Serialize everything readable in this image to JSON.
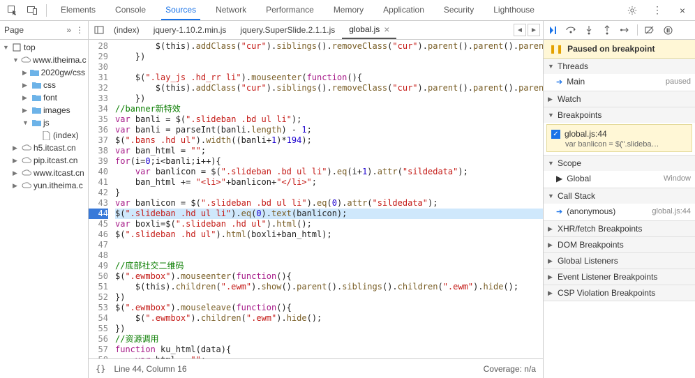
{
  "topTabs": [
    "Elements",
    "Console",
    "Sources",
    "Network",
    "Performance",
    "Memory",
    "Application",
    "Security",
    "Lighthouse"
  ],
  "topActiveIndex": 2,
  "sidebar": {
    "title": "Page",
    "tree": [
      {
        "level": 0,
        "caret": "▼",
        "iconType": "frame",
        "label": "top"
      },
      {
        "level": 1,
        "caret": "▼",
        "iconType": "cloud",
        "label": "www.itheima.c"
      },
      {
        "level": 2,
        "caret": "▶",
        "iconType": "folder",
        "label": "2020gw/css"
      },
      {
        "level": 2,
        "caret": "▶",
        "iconType": "folder",
        "label": "css"
      },
      {
        "level": 2,
        "caret": "▶",
        "iconType": "folder",
        "label": "font"
      },
      {
        "level": 2,
        "caret": "▶",
        "iconType": "folder",
        "label": "images"
      },
      {
        "level": 2,
        "caret": "▼",
        "iconType": "folder",
        "label": "js"
      },
      {
        "level": 3,
        "caret": "",
        "iconType": "file",
        "label": "(index)"
      },
      {
        "level": 1,
        "caret": "▶",
        "iconType": "cloud",
        "label": "h5.itcast.cn"
      },
      {
        "level": 1,
        "caret": "▶",
        "iconType": "cloud",
        "label": "pip.itcast.cn"
      },
      {
        "level": 1,
        "caret": "▶",
        "iconType": "cloud",
        "label": "www.itcast.cn"
      },
      {
        "level": 1,
        "caret": "▶",
        "iconType": "cloud",
        "label": "yun.itheima.c"
      }
    ]
  },
  "fileTabs": [
    "(index)",
    "jquery-1.10.2.min.js",
    "jquery.SuperSlide.2.1.1.js",
    "global.js"
  ],
  "fileActiveIndex": 3,
  "code": {
    "startLine": 28,
    "pausedLine": 44,
    "lines": [
      "        $(this).addClass(\"cur\").siblings().removeClass(\"cur\").parent().parent().parent().sibl",
      "    })",
      "",
      "    $(\".lay_js .hd_rr li\").mouseenter(function(){",
      "        $(this).addClass(\"cur\").siblings().removeClass(\"cur\").parent().parent().parent().sibl",
      "    })",
      "//banner新特效",
      "var banli = $(\".slideban .bd ul li\");",
      "var banli = parseInt(banli.length) - 1;",
      "$(\".bans .hd ul\").width((banli+1)*194);",
      "var ban_html = \"\";",
      "for(i=0;i<banli;i++){",
      "    var banlicon = $(\".slideban .bd ul li\").eq(i+1).attr(\"sildedata\");",
      "    ban_html += \"<li>\"+banlicon+\"</li>\";",
      "}",
      "var banlicon = $(\".slideban .bd ul li\").eq(0).attr(\"sildedata\");",
      "$(\".slideban .hd ul li\").eq(0).text(banlicon);",
      "var boxli=$(\".slideban .hd ul\").html();",
      "$(\".slideban .hd ul\").html(boxli+ban_html);",
      "",
      "",
      "//底部社交二维码",
      "$(\".ewmbox\").mouseenter(function(){",
      "    $(this).children(\".ewm\").show().parent().siblings().children(\".ewm\").hide();",
      "})",
      "$(\".ewmbox\").mouseleave(function(){",
      "    $(\".ewmbox\").children(\".ewm\").hide();",
      "})",
      "//资源调用",
      "function ku_html(data){",
      "    var html = \"\";",
      ""
    ]
  },
  "status": {
    "position": "Line 44, Column 16",
    "coverage": "Coverage: n/a"
  },
  "debugger": {
    "pausedText": "Paused on breakpoint",
    "sections": {
      "threads": {
        "label": "Threads",
        "open": true,
        "rows": [
          {
            "name": "Main",
            "tag": "paused",
            "arrow": true
          }
        ]
      },
      "watch": {
        "label": "Watch",
        "open": false
      },
      "breakpoints": {
        "label": "Breakpoints",
        "open": true,
        "item": {
          "title": "global.js:44",
          "sub": "var banlicon = $(\".slideba…"
        }
      },
      "scope": {
        "label": "Scope",
        "open": true,
        "rows": [
          {
            "name": "Global",
            "tag": "Window"
          }
        ]
      },
      "callstack": {
        "label": "Call Stack",
        "open": true,
        "rows": [
          {
            "name": "(anonymous)",
            "tag": "global.js:44",
            "arrow": true
          }
        ]
      },
      "others": [
        "XHR/fetch Breakpoints",
        "DOM Breakpoints",
        "Global Listeners",
        "Event Listener Breakpoints",
        "CSP Violation Breakpoints"
      ]
    }
  }
}
